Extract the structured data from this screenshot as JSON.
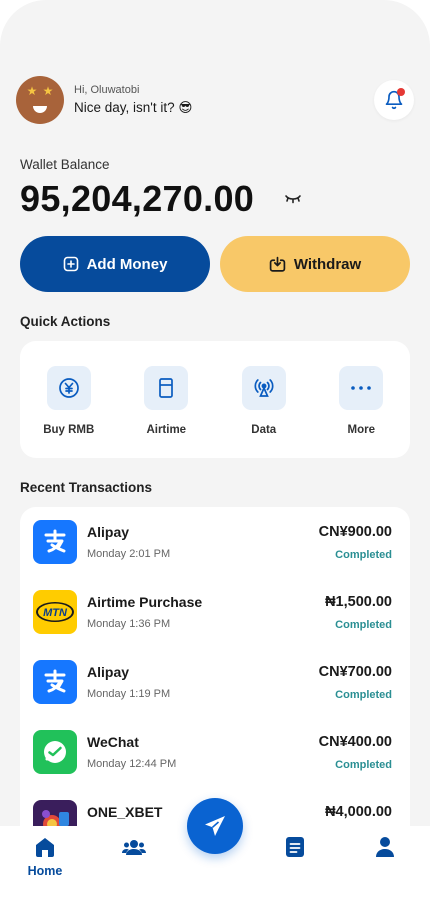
{
  "user": {
    "greeting": "Hi, Oluwatobi",
    "message": "Nice day, isn't it? 😎"
  },
  "wallet": {
    "label": "Wallet Balance",
    "amount": "95,204,270.00"
  },
  "actions": {
    "add_money": "Add Money",
    "withdraw": "Withdraw"
  },
  "quick_actions": {
    "title": "Quick Actions",
    "items": [
      {
        "label": "Buy RMB",
        "icon": "yuan-coin-icon"
      },
      {
        "label": "Airtime",
        "icon": "phone-icon"
      },
      {
        "label": "Data",
        "icon": "signal-tower-icon"
      },
      {
        "label": "More",
        "icon": "more-dots-icon"
      }
    ]
  },
  "transactions": {
    "title": "Recent Transactions",
    "items": [
      {
        "name": "Alipay",
        "time": "Monday 2:01 PM",
        "amount": "CN¥900.00",
        "status": "Completed",
        "logo": "alipay-logo"
      },
      {
        "name": "Airtime Purchase",
        "time": "Monday 1:36 PM",
        "amount": "₦1,500.00",
        "status": "Completed",
        "logo": "mtn-logo",
        "logo_text": "MTN"
      },
      {
        "name": "Alipay",
        "time": "Monday 1:19 PM",
        "amount": "CN¥700.00",
        "status": "Completed",
        "logo": "alipay-logo"
      },
      {
        "name": "WeChat",
        "time": "Monday 12:44 PM",
        "amount": "CN¥400.00",
        "status": "Completed",
        "logo": "wechat-logo"
      },
      {
        "name": "ONE_XBET",
        "time": "",
        "amount": "₦4,000.00",
        "status": "",
        "logo": "onexbet-logo"
      }
    ]
  },
  "nav": {
    "home": "Home"
  },
  "colors": {
    "primary": "#064b9c",
    "accent": "#f8c868",
    "status": "#2a8f93",
    "fab": "#0a63d1"
  }
}
